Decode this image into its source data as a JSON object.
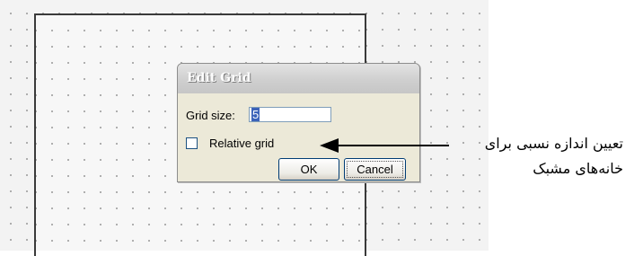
{
  "dialog": {
    "title": "Edit Grid",
    "grid_size_label": "Grid size:",
    "grid_size_value": "5",
    "relative_grid_label": "Relative grid",
    "relative_grid_checked": false,
    "ok_label": "OK",
    "cancel_label": "Cancel"
  },
  "annotation": {
    "line1": "تعیین اندازه نسبی برای",
    "line2": "خانه‌های مشبک"
  },
  "colors": {
    "dialog_background": "#ece9d8",
    "input_border": "#7f9db9",
    "selection": "#3c63b9",
    "button_border": "#003c74"
  }
}
